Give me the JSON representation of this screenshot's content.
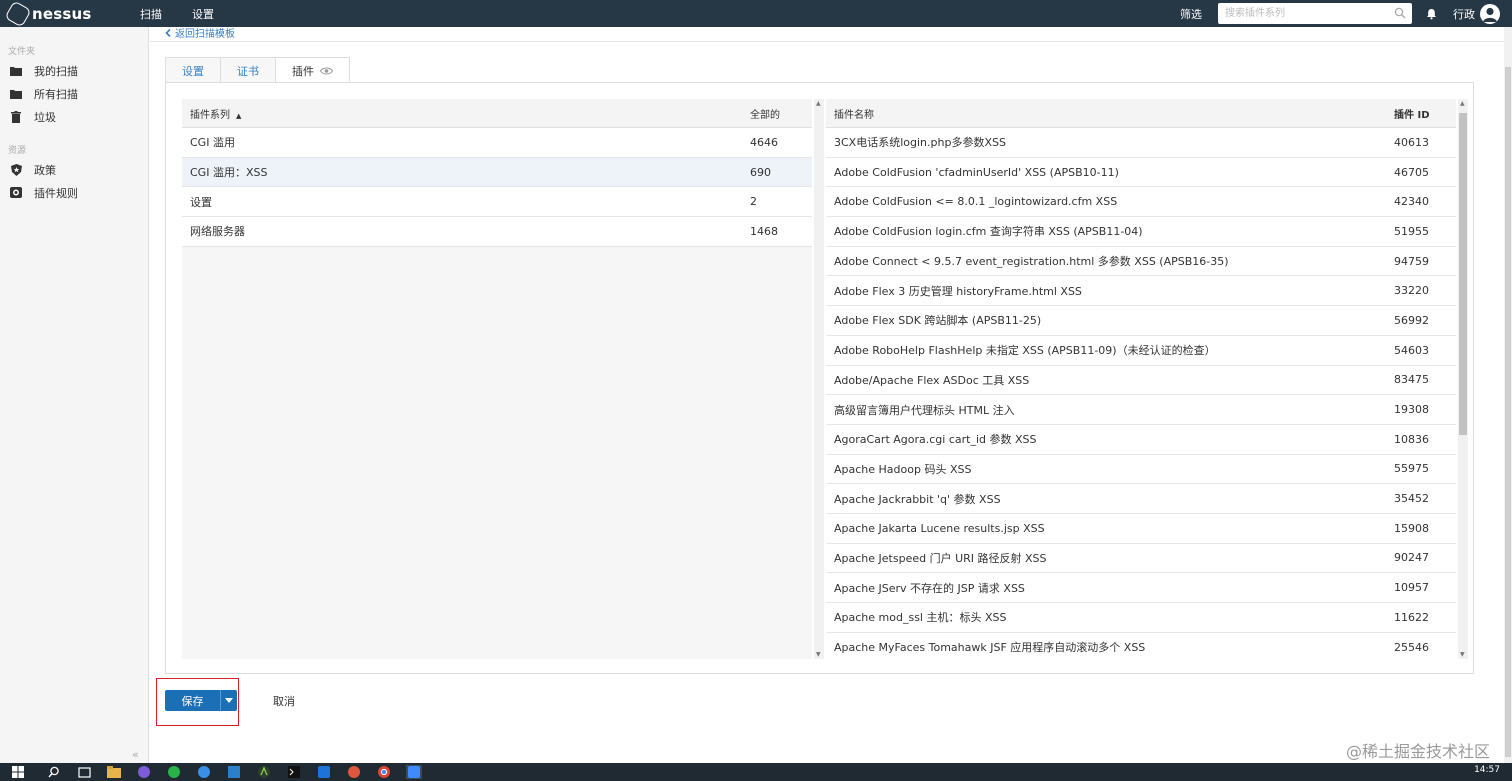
{
  "app": {
    "name": "nessus",
    "nav": [
      "扫描",
      "设置"
    ]
  },
  "topbar": {
    "filter": "筛选",
    "search_placeholder": "搜索插件系列",
    "user": "行政"
  },
  "sidebar": {
    "sections": [
      {
        "label": "文件夹",
        "items": [
          {
            "label": "我的扫描",
            "icon": "folder-icon"
          },
          {
            "label": "所有扫描",
            "icon": "folder-icon"
          },
          {
            "label": "垃圾",
            "icon": "trash-icon"
          }
        ]
      },
      {
        "label": "资源",
        "items": [
          {
            "label": "政策",
            "icon": "shield-icon"
          },
          {
            "label": "插件规则",
            "icon": "plugin-rules-icon"
          }
        ]
      }
    ],
    "collapse": "«"
  },
  "main": {
    "back_link": "返回扫描模板",
    "tabs": [
      {
        "label": "设置"
      },
      {
        "label": "证书"
      },
      {
        "label": "插件",
        "active": true
      }
    ],
    "left_table": {
      "headers": [
        "插件系列",
        "全部的"
      ],
      "rows": [
        {
          "name": "CGI 滥用",
          "count": "4646"
        },
        {
          "name": "CGI 滥用：XSS",
          "count": "690",
          "selected": true
        },
        {
          "name": "设置",
          "count": "2"
        },
        {
          "name": "网络服务器",
          "count": "1468"
        }
      ]
    },
    "right_table": {
      "headers": [
        "插件名称",
        "插件 ID"
      ],
      "rows": [
        {
          "name": "3CX电话系统login.php多参数XSS",
          "id": "40613"
        },
        {
          "name": "Adobe ColdFusion 'cfadminUserId' XSS (APSB10-11)",
          "id": "46705"
        },
        {
          "name": "Adobe ColdFusion <= 8.0.1 _logintowizard.cfm XSS",
          "id": "42340"
        },
        {
          "name": "Adobe ColdFusion login.cfm 查询字符串 XSS (APSB11-04)",
          "id": "51955"
        },
        {
          "name": "Adobe Connect < 9.5.7 event_registration.html 多参数 XSS (APSB16-35)",
          "id": "94759"
        },
        {
          "name": "Adobe Flex 3 历史管理 historyFrame.html XSS",
          "id": "33220"
        },
        {
          "name": "Adobe Flex SDK 跨站脚本 (APSB11-25)",
          "id": "56992"
        },
        {
          "name": "Adobe RoboHelp FlashHelp 未指定 XSS (APSB11-09)（未经认证的检查）",
          "id": "54603"
        },
        {
          "name": "Adobe/Apache Flex ASDoc 工具 XSS",
          "id": "83475"
        },
        {
          "name": "高级留言簿用户代理标头 HTML 注入",
          "id": "19308"
        },
        {
          "name": "AgoraCart Agora.cgi cart_id 参数 XSS",
          "id": "10836"
        },
        {
          "name": "Apache Hadoop 码头 XSS",
          "id": "55975"
        },
        {
          "name": "Apache Jackrabbit 'q' 参数 XSS",
          "id": "35452"
        },
        {
          "name": "Apache Jakarta Lucene results.jsp XSS",
          "id": "15908"
        },
        {
          "name": "Apache Jetspeed 门户 URI 路径反射 XSS",
          "id": "90247"
        },
        {
          "name": "Apache JServ 不存在的 JSP 请求 XSS",
          "id": "10957"
        },
        {
          "name": "Apache mod_ssl 主机：标头 XSS",
          "id": "11622"
        },
        {
          "name": "Apache MyFaces Tomahawk JSF 应用程序自动滚动多个 XSS",
          "id": "25546"
        }
      ]
    },
    "actions": {
      "save": "保存",
      "cancel": "取消"
    }
  },
  "watermark": "@稀土掘金技术社区",
  "taskbar": {
    "time": "14:57"
  },
  "colors": {
    "topbar": "#263746",
    "accent": "#1a6fb5",
    "link": "#3a7fc1",
    "highlight": "#d81e2a"
  }
}
